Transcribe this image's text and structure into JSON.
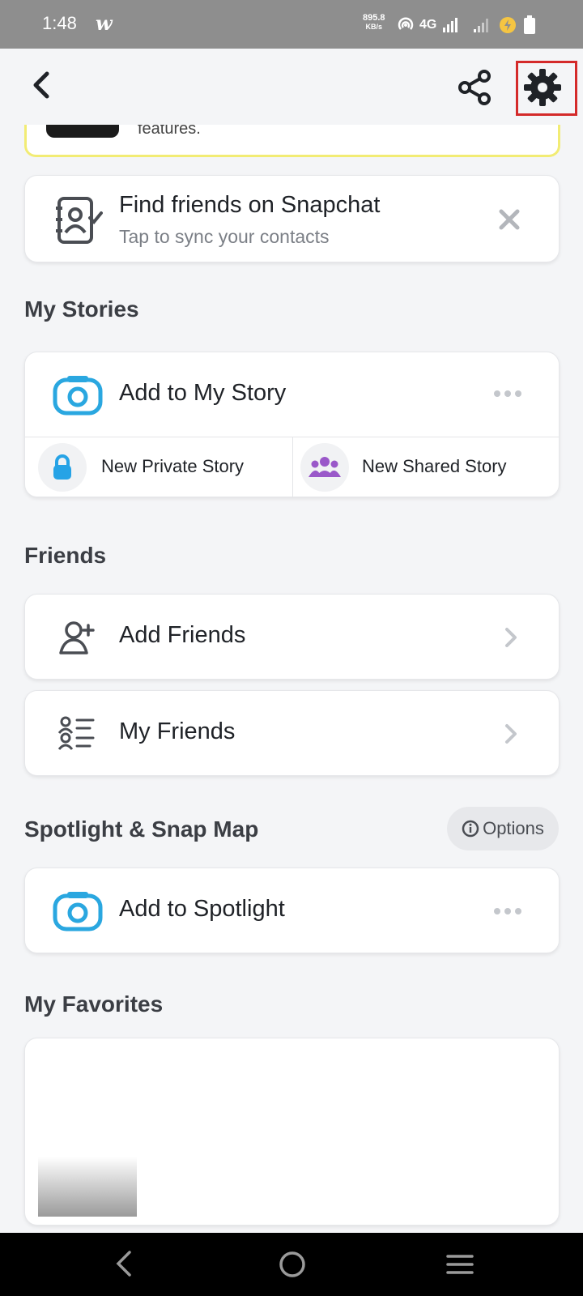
{
  "status_bar": {
    "time": "1:48",
    "app_logo": "w",
    "net_speed_value": "895.8",
    "net_speed_unit": "KB/s",
    "network": "4G"
  },
  "banner": {
    "text": "features."
  },
  "find_friends": {
    "title": "Find friends on Snapchat",
    "subtitle": "Tap to sync your contacts"
  },
  "my_stories": {
    "heading": "My Stories",
    "add_label": "Add to My Story",
    "private_label": "New Private Story",
    "shared_label": "New Shared Story"
  },
  "friends": {
    "heading": "Friends",
    "add_friends": "Add Friends",
    "my_friends": "My Friends"
  },
  "spotlight": {
    "heading": "Spotlight & Snap Map",
    "options_label": "Options",
    "add_label": "Add to Spotlight"
  },
  "favorites": {
    "heading": "My Favorites"
  },
  "colors": {
    "accent_blue": "#2aa7e0",
    "lock_blue": "#26a3e6",
    "group_purple": "#9a58c9",
    "highlight_red": "#d42a2a",
    "banner_yellow": "#f2ec74"
  }
}
